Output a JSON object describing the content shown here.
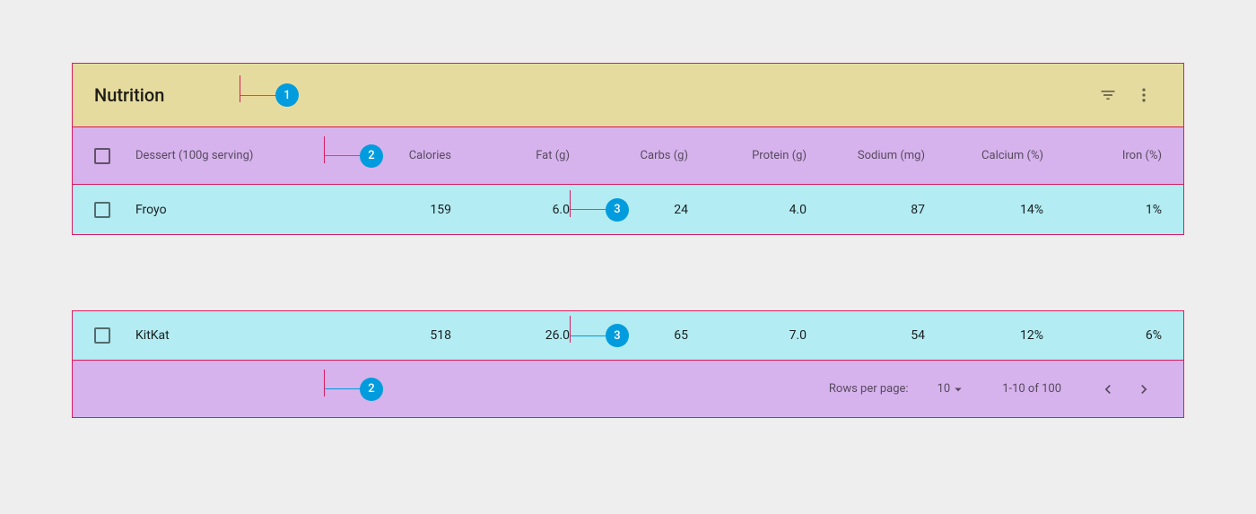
{
  "toolbar": {
    "title": "Nutrition"
  },
  "columns": {
    "name": "Dessert (100g serving)",
    "calories": "Calories",
    "fat": "Fat (g)",
    "carbs": "Carbs (g)",
    "protein": "Protein (g)",
    "sodium": "Sodium (mg)",
    "calcium": "Calcium (%)",
    "iron": "Iron (%)"
  },
  "rows": [
    {
      "name": "Froyo",
      "calories": "159",
      "fat": "6.0",
      "carbs": "24",
      "protein": "4.0",
      "sodium": "87",
      "calcium": "14%",
      "iron": "1%"
    },
    {
      "name": "KitKat",
      "calories": "518",
      "fat": "26.0",
      "carbs": "65",
      "protein": "7.0",
      "sodium": "54",
      "calcium": "12%",
      "iron": "6%"
    }
  ],
  "footer": {
    "rows_per_page_label": "Rows per page:",
    "rows_per_page_value": "10",
    "range": "1-10 of 100"
  },
  "annotations": {
    "toolbar": "1",
    "header": "2",
    "data": "3",
    "footer": "2"
  }
}
